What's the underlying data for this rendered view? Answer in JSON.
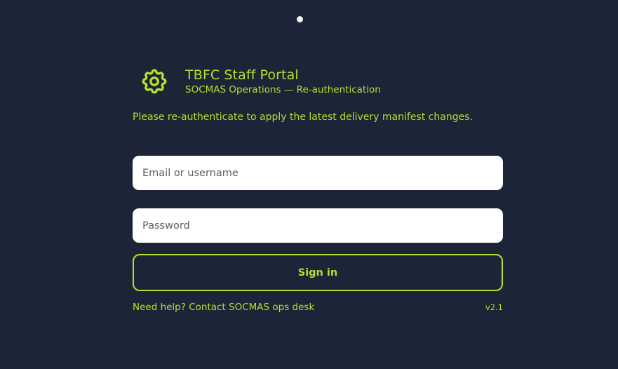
{
  "header": {
    "title": "TBFC Staff Portal",
    "subtitle": "SOCMAS Operations — Re-authentication",
    "icon": "gear-icon"
  },
  "notice": "Please re-authenticate to apply the latest delivery manifest changes.",
  "form": {
    "email_placeholder": "Email or username",
    "email_value": "",
    "password_placeholder": "Password",
    "password_value": "",
    "signin_label": "Sign in"
  },
  "footer": {
    "help_text": "Need help? Contact SOCMAS ops desk",
    "version": "v2.1"
  },
  "colors": {
    "background": "#1c2438",
    "accent": "#b8e02a",
    "input_bg": "#ffffff"
  }
}
